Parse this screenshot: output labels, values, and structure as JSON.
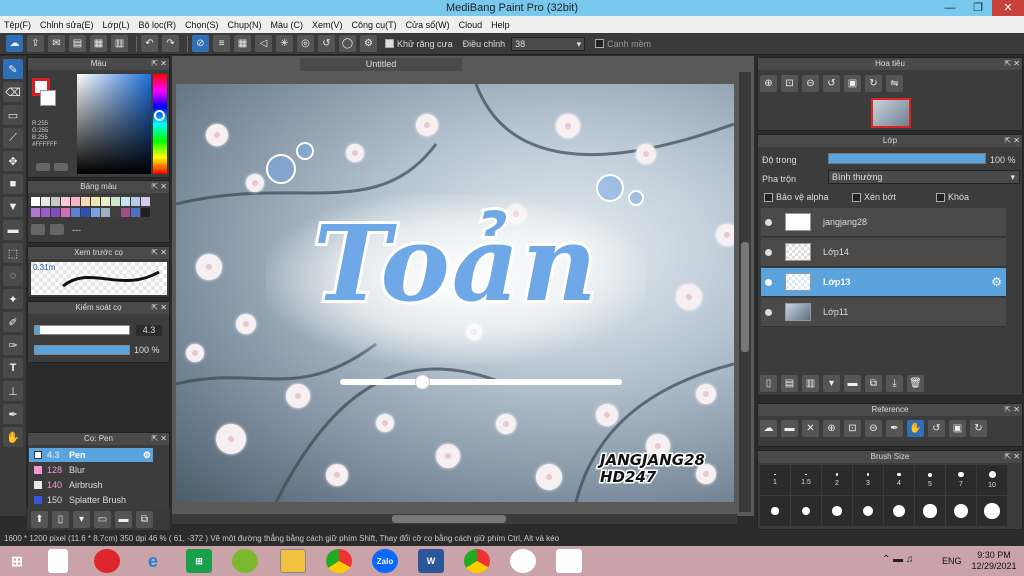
{
  "window": {
    "title": "MediBang Paint Pro (32bit)",
    "minimize": "—",
    "maximize": "❐",
    "close": "✕"
  },
  "menu": [
    "Tệp(F)",
    "Chỉnh sửa(E)",
    "Lớp(L)",
    "Bộ lọc(R)",
    "Chọn(S)",
    "Chụp(N)",
    "Màu (C)",
    "Xem(V)",
    "Công cụ(T)",
    "Cửa sổ(W)",
    "Cloud",
    "Help"
  ],
  "toolbar": {
    "antialias_label": "Khử răng cưa",
    "adjust_label": "Điều chỉnh",
    "adjust_value": "38",
    "smooth_label": "Cạnh mềm"
  },
  "color_panel": {
    "title": "Màu",
    "r": "R:255",
    "g": "G:255",
    "b": "B:255",
    "hex": "#FFFFFF"
  },
  "palette_panel": {
    "title": "Bảng màu",
    "dash": "---"
  },
  "brush_preview": {
    "title": "Xem trước cọ",
    "size": "0.31m"
  },
  "brush_control": {
    "title": "Kiểm soát cọ",
    "size_value": "4.3",
    "opacity_value": "100 %"
  },
  "brush_list": {
    "title": "Cọ: Pen",
    "items": [
      {
        "size": "4.3",
        "name": "Pen",
        "color": "#ffffff"
      },
      {
        "size": "128",
        "name": "Blur",
        "color": "#f39ad6"
      },
      {
        "size": "140",
        "name": "Airbrush",
        "color": "#e8e8e8"
      },
      {
        "size": "150",
        "name": "Splatter Brush",
        "color": "#3a55e0"
      }
    ]
  },
  "canvas": {
    "tab": "Untitled",
    "artwork_title": "Toản",
    "watermark_line1": "JANGJANG28",
    "watermark_line2": "HD247",
    "slider_level": 0.28
  },
  "navigator": {
    "title": "Hoa tiêu"
  },
  "layers": {
    "title": "Lớp",
    "opacity_label": "Độ trong",
    "opacity_value": "100 %",
    "opacity_level": 1.0,
    "blend_label": "Pha trộn",
    "blend_value": "Bình thường",
    "protect_alpha": "Bảo vệ alpha",
    "clipping": "Xén bớt",
    "lock": "Khóa",
    "items": [
      {
        "name": "jangjang28"
      },
      {
        "name": "Lớp14"
      },
      {
        "name": "Lớp13"
      },
      {
        "name": "Lớp11"
      }
    ]
  },
  "reference": {
    "title": "Reference"
  },
  "brush_size": {
    "title": "Brush Size",
    "sizes": [
      "1",
      "1.5",
      "2",
      "3",
      "4",
      "5",
      "7",
      "10"
    ]
  },
  "status": {
    "text": "1600 * 1200 pixel   (11.6 * 8.7cm)   350 dpi   46 %   ( 61, -372 )   Vẽ một đường thẳng bằng cách giữ phím Shift, Thay đổi cỡ cọ bằng cách giữ phím Ctrl, Alt và kéo"
  },
  "taskbar": {
    "lang": "ENG",
    "time": "9:30 PM",
    "date": "12/29/2021",
    "zalo": "Zalo",
    "word": "W"
  }
}
